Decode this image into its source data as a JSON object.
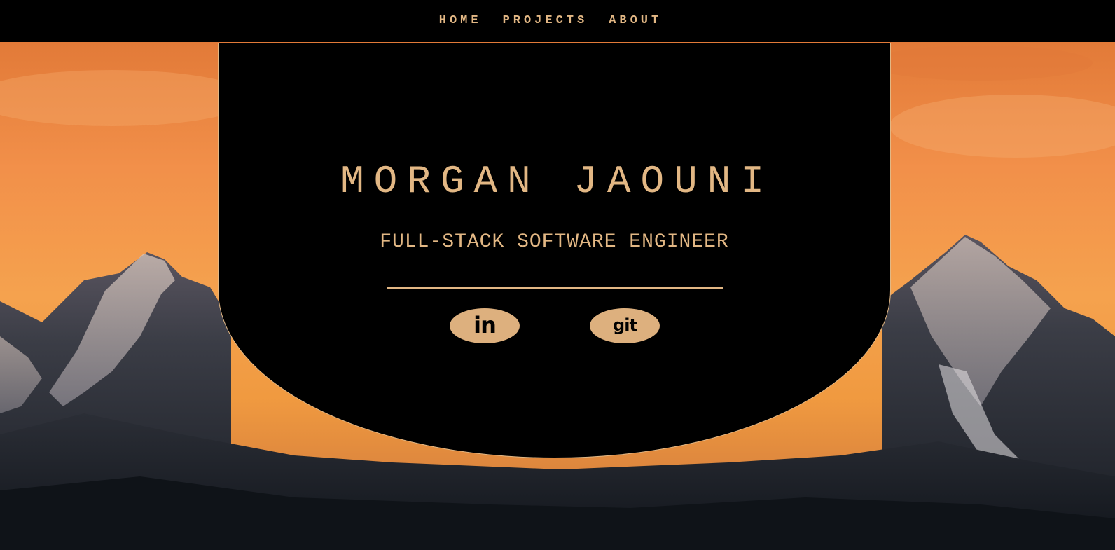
{
  "nav": {
    "items": [
      {
        "label": "HOME"
      },
      {
        "label": "PROJECTS"
      },
      {
        "label": "ABOUT"
      }
    ]
  },
  "hero": {
    "name": "MORGAN JAOUNI",
    "subtitle": "FULL-STACK SOFTWARE ENGINEER",
    "social": [
      {
        "label": "in",
        "icon": "linkedin-icon"
      },
      {
        "label": "git",
        "icon": "github-icon"
      }
    ]
  },
  "colors": {
    "accent": "#e2b784",
    "background": "#000000",
    "sky_top": "#f08a3e",
    "sky_bottom": "#f7a655",
    "mountain_dark": "#1d2128"
  }
}
